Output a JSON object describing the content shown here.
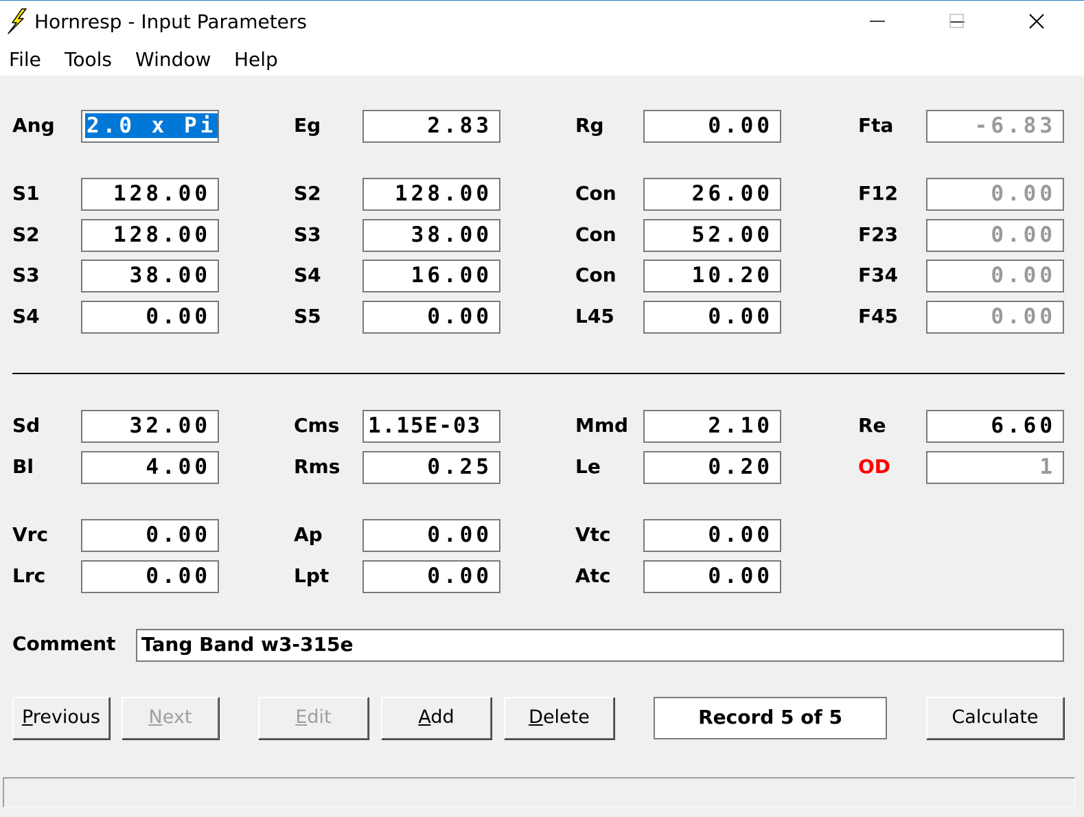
{
  "window": {
    "title": "Hornresp - Input Parameters",
    "controls": [
      "minimize",
      "maximize",
      "close"
    ]
  },
  "menu": [
    "File",
    "Tools",
    "Window",
    "Help"
  ],
  "fields": [
    {
      "label": "Ang",
      "value": "2.0 x Pi",
      "state": "selected"
    },
    {
      "label": "Eg",
      "value": "2.83",
      "state": "normal"
    },
    {
      "label": "Rg",
      "value": "0.00",
      "state": "normal"
    },
    {
      "label": "Fta",
      "value": "-6.83",
      "state": "readonly"
    },
    {
      "label": "S1",
      "value": "128.00",
      "state": "normal"
    },
    {
      "label": "S2",
      "value": "128.00",
      "state": "normal"
    },
    {
      "label": "Con",
      "value": "26.00",
      "state": "normal"
    },
    {
      "label": "F12",
      "value": "0.00",
      "state": "readonly"
    },
    {
      "label": "S2",
      "value": "128.00",
      "state": "normal"
    },
    {
      "label": "S3",
      "value": "38.00",
      "state": "normal"
    },
    {
      "label": "Con",
      "value": "52.00",
      "state": "normal"
    },
    {
      "label": "F23",
      "value": "0.00",
      "state": "readonly"
    },
    {
      "label": "S3",
      "value": "38.00",
      "state": "normal"
    },
    {
      "label": "S4",
      "value": "16.00",
      "state": "normal"
    },
    {
      "label": "Con",
      "value": "10.20",
      "state": "normal"
    },
    {
      "label": "F34",
      "value": "0.00",
      "state": "readonly"
    },
    {
      "label": "S4",
      "value": "0.00",
      "state": "normal"
    },
    {
      "label": "S5",
      "value": "0.00",
      "state": "normal"
    },
    {
      "label": "L45",
      "value": "0.00",
      "state": "normal"
    },
    {
      "label": "F45",
      "value": "0.00",
      "state": "readonly"
    },
    {
      "label": "Sd",
      "value": "32.00",
      "state": "normal"
    },
    {
      "label": "Cms",
      "value": "1.15E-03",
      "state": "normal"
    },
    {
      "label": "Mmd",
      "value": "2.10",
      "state": "normal"
    },
    {
      "label": "Re",
      "value": "6.60",
      "state": "normal"
    },
    {
      "label": "Bl",
      "value": "4.00",
      "state": "normal"
    },
    {
      "label": "Rms",
      "value": "0.25",
      "state": "normal"
    },
    {
      "label": "Le",
      "value": "0.20",
      "state": "normal"
    },
    {
      "label": "OD",
      "value": "1",
      "state": "readonly",
      "label_color": "#ff0000"
    },
    {
      "label": "Vrc",
      "value": "0.00",
      "state": "normal"
    },
    {
      "label": "Ap",
      "value": "0.00",
      "state": "normal"
    },
    {
      "label": "Vtc",
      "value": "0.00",
      "state": "normal"
    },
    {
      "label": "Lrc",
      "value": "0.00",
      "state": "normal"
    },
    {
      "label": "Lpt",
      "value": "0.00",
      "state": "normal"
    },
    {
      "label": "Atc",
      "value": "0.00",
      "state": "normal"
    }
  ],
  "comment": {
    "label": "Comment",
    "value": "Tang Band w3-315e"
  },
  "buttons": {
    "previous": {
      "label": "Previous",
      "enabled": true
    },
    "next": {
      "label": "Next",
      "enabled": false
    },
    "edit": {
      "label": "Edit",
      "enabled": false
    },
    "add": {
      "label": "Add",
      "enabled": true
    },
    "delete": {
      "label": "Delete",
      "enabled": true
    },
    "calculate": {
      "label": "Calculate",
      "enabled": true
    }
  },
  "record_status": "Record 5 of 5",
  "colors": {
    "selection": "#0078d7",
    "od_label": "#ff0000",
    "disabled_text": "#a0a0a0"
  }
}
